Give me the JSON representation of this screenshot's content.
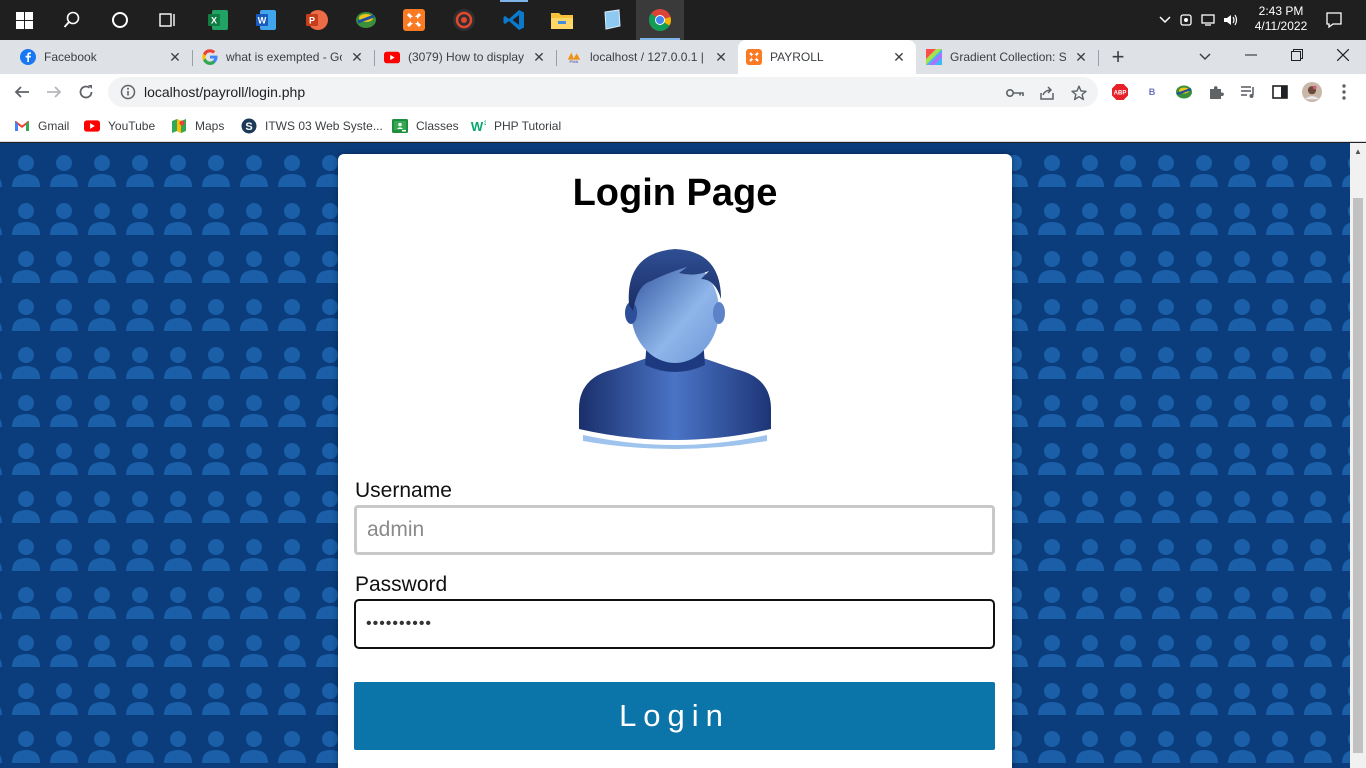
{
  "taskbar": {
    "clock_time": "2:43 PM",
    "clock_date": "4/11/2022",
    "apps": [
      "start",
      "search",
      "cortana",
      "task-view",
      "excel",
      "word",
      "powerpoint",
      "idm",
      "xampp",
      "obs",
      "vscode",
      "file-explorer",
      "notepad",
      "chrome"
    ]
  },
  "tabs": [
    {
      "title": "Facebook"
    },
    {
      "title": "what is exempted - Go"
    },
    {
      "title": "(3079) How to display"
    },
    {
      "title": "localhost / 127.0.0.1 | p"
    },
    {
      "title": "PAYROLL"
    },
    {
      "title": "Gradient Collection: S"
    }
  ],
  "toolbar": {
    "url": "localhost/payroll/login.php",
    "abp_label": "ABP",
    "ext_b_label": "B"
  },
  "bookmarks": [
    {
      "label": "Gmail"
    },
    {
      "label": "YouTube"
    },
    {
      "label": "Maps"
    },
    {
      "label": "ITWS 03 Web Syste..."
    },
    {
      "label": "Classes"
    },
    {
      "label": "PHP Tutorial"
    }
  ],
  "login": {
    "title": "Login Page",
    "username_label": "Username",
    "username_placeholder": "admin",
    "password_label": "Password",
    "password_value": "••••••••••",
    "button_label": "Login"
  },
  "colors": {
    "page_background": "#0b3d7d",
    "pattern_figure": "#1a5fa8",
    "login_button": "#0b74a8"
  }
}
